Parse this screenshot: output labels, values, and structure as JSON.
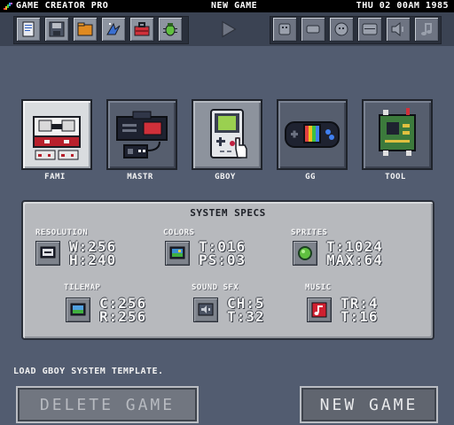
{
  "menubar": {
    "app_title": "GAME CREATOR PRO",
    "document_title": "NEW GAME",
    "clock": "THU 02 00AM 1985"
  },
  "toolbar": {
    "left_icons": [
      "document-icon",
      "save-icon",
      "folder-icon",
      "magic-icon",
      "toolbox-icon",
      "bug-icon"
    ],
    "play_icon": "play-icon",
    "right_icons": [
      "sprite-editor-icon",
      "tile-editor-icon",
      "palette-icon",
      "map-icon",
      "sound-icon",
      "music-icon"
    ]
  },
  "systems": [
    {
      "label": "FAMI",
      "icon": "famicom-console-icon"
    },
    {
      "label": "MASTR",
      "icon": "master-system-console-icon"
    },
    {
      "label": "GBOY",
      "icon": "gameboy-handheld-icon",
      "selected": true
    },
    {
      "label": "GG",
      "icon": "gamegear-handheld-icon"
    },
    {
      "label": "TOOL",
      "icon": "circuit-board-icon"
    }
  ],
  "specs": {
    "title": "SYSTEM SPECS",
    "resolution": {
      "label": "RESOLUTION",
      "line1": "W:256",
      "line2": "H:240"
    },
    "colors": {
      "label": "COLORS",
      "line1": "T:016",
      "line2": "PS:03"
    },
    "sprites": {
      "label": "SPRITES",
      "line1": "T:1024",
      "line2": "MAX:64"
    },
    "tilemap": {
      "label": "TILEMAP",
      "line1": "C:256",
      "line2": "R:256"
    },
    "sound": {
      "label": "SOUND SFX",
      "line1": "CH:5",
      "line2": "T:32"
    },
    "music": {
      "label": "MUSIC",
      "line1": "TR:4",
      "line2": "T:16"
    }
  },
  "status_text": "LOAD GBOY SYSTEM TEMPLATE.",
  "buttons": {
    "delete": "DELETE GAME",
    "new": "NEW GAME"
  }
}
